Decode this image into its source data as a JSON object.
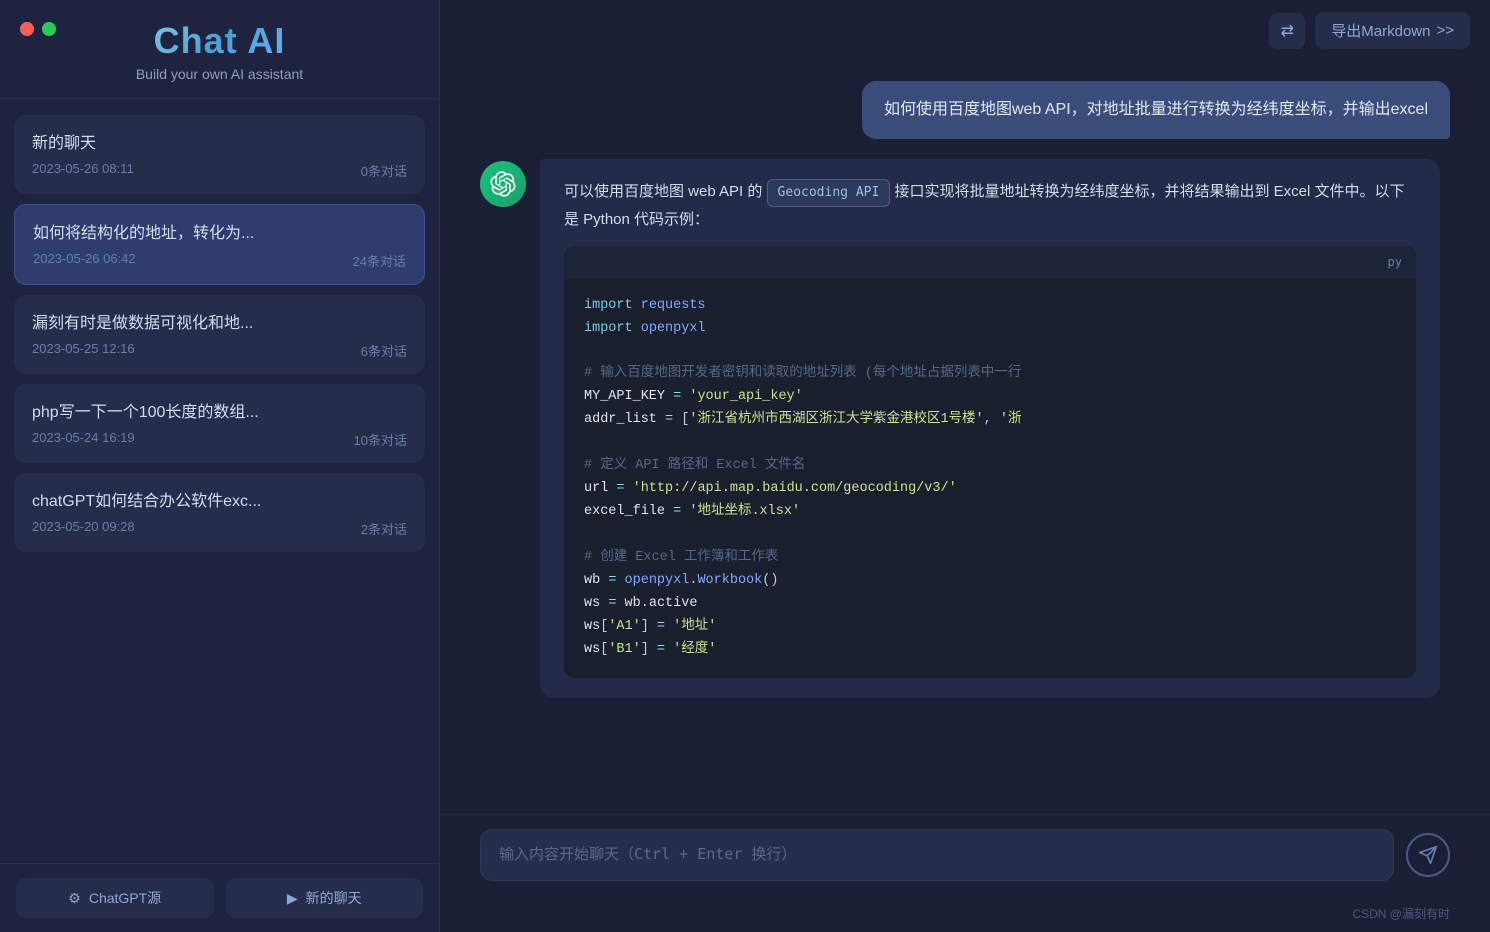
{
  "app": {
    "title": "Chat AI",
    "subtitle": "Build your own AI assistant"
  },
  "window_controls": {
    "red_label": "",
    "green_label": ""
  },
  "header": {
    "export_icon": "⇄",
    "export_label": "导出Markdown",
    "export_arrow": ">>"
  },
  "chat_list": [
    {
      "id": 1,
      "title": "新的聊天",
      "date": "2023-05-26 08:11",
      "count": "0条对话",
      "active": false
    },
    {
      "id": 2,
      "title": "如何将结构化的地址，转化为...",
      "date": "2023-05-26 06:42",
      "count": "24条对话",
      "active": true
    },
    {
      "id": 3,
      "title": "漏刻有时是做数据可视化和地...",
      "date": "2023-05-25 12:16",
      "count": "6条对话",
      "active": false
    },
    {
      "id": 4,
      "title": "php写一下一个100长度的数组...",
      "date": "2023-05-24 16:19",
      "count": "10条对话",
      "active": false
    },
    {
      "id": 5,
      "title": "chatGPT如何结合办公软件exc...",
      "date": "2023-05-20 09:28",
      "count": "2条对话",
      "active": false
    }
  ],
  "footer_buttons": [
    {
      "id": "source",
      "icon": "⚙",
      "label": "ChatGPT源"
    },
    {
      "id": "new",
      "icon": "▶",
      "label": "新的聊天"
    }
  ],
  "user_message": {
    "text": "如何使用百度地图web API，对地址批量进行转换为经纬度坐标，并输出excel"
  },
  "ai_response": {
    "prefix_text": "可以使用百度地图 web API 的",
    "badge": "Geocoding API",
    "suffix_text": "接口实现将批量地址转换为经纬度坐标，并将结果输出到 Excel 文件中。以下是 Python 代码示例：",
    "code_lang": "py",
    "code_lines": [
      {
        "type": "import",
        "content": "import requests"
      },
      {
        "type": "import",
        "content": "import openpyxl"
      },
      {
        "type": "blank"
      },
      {
        "type": "comment",
        "content": "# 输入百度地图开发者密钥和读取的地址列表 (每个地址占据列表中一行"
      },
      {
        "type": "assign",
        "var": "MY_API_KEY",
        "op": "=",
        "val": "'your_api_key'"
      },
      {
        "type": "assign",
        "var": "addr_list",
        "op": "=",
        "val": "['浙江省杭州市西湖区浙江大学紫金港校区1号楼', '浙"
      },
      {
        "type": "blank"
      },
      {
        "type": "comment",
        "content": "# 定义 API 路径和 Excel 文件名"
      },
      {
        "type": "assign",
        "var": "url",
        "op": "=",
        "val": "'http://api.map.baidu.com/geocoding/v3/'"
      },
      {
        "type": "assign",
        "var": "excel_file",
        "op": "=",
        "val": "'地址坐标.xlsx'"
      },
      {
        "type": "blank"
      },
      {
        "type": "comment",
        "content": "# 创建 Excel 工作簿和工作表"
      },
      {
        "type": "assign",
        "var": "wb",
        "op": "=",
        "val": "openpyxl.Workbook()"
      },
      {
        "type": "assign",
        "var": "ws",
        "op": "=",
        "val": "wb.active"
      },
      {
        "type": "assign",
        "var": "ws['A1']",
        "op": "=",
        "val": "'地址'"
      },
      {
        "type": "assign",
        "var": "ws['B1']",
        "op": "=",
        "val": "'经度'"
      }
    ]
  },
  "input": {
    "placeholder": "输入内容开始聊天（Ctrl + Enter 换行）"
  },
  "footer_note": "CSDN @漏刻有时"
}
